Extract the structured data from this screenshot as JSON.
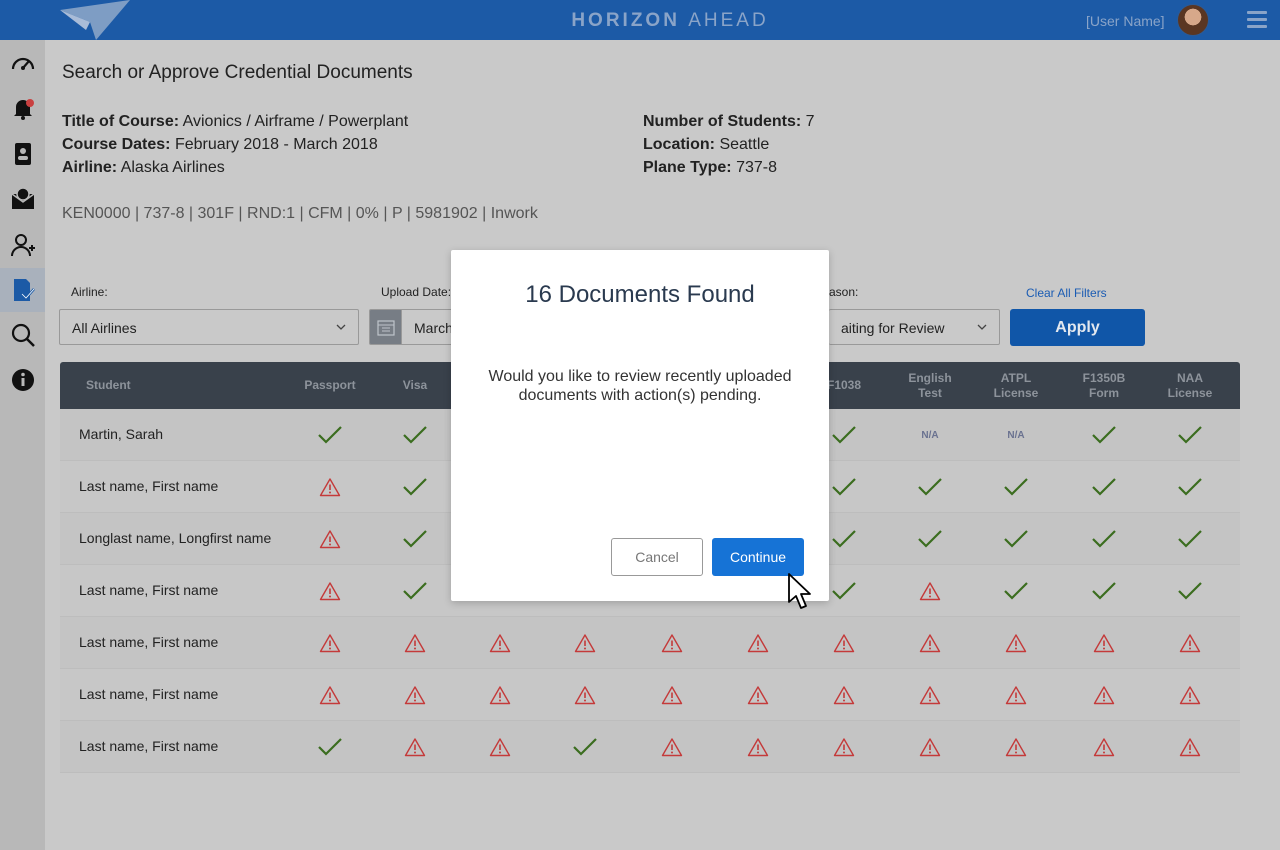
{
  "header": {
    "brand_bold": "HORIZON",
    "brand_light": "AHEAD",
    "user_name": "[User Name]"
  },
  "sidebar": {
    "items": [
      {
        "icon": "speedometer-icon"
      },
      {
        "icon": "bell-icon",
        "badge": "notification"
      },
      {
        "icon": "id-card-icon"
      },
      {
        "icon": "mail-badge-icon"
      },
      {
        "icon": "add-user-icon"
      },
      {
        "icon": "document-check-icon",
        "active": true
      },
      {
        "icon": "search-icon"
      },
      {
        "icon": "info-icon"
      }
    ]
  },
  "page": {
    "title": "Search or Approve Credential Documents",
    "course_title_label": "Title of Course:",
    "course_title": "Avionics / Airframe / Powerplant",
    "course_dates_label": "Course Dates:",
    "course_dates": "February 2018 - March 2018",
    "airline_label": "Airline:",
    "airline": "Alaska Airlines",
    "students_label": "Number of Students:",
    "students": "7",
    "location_label": "Location:",
    "location": "Seattle",
    "plane_label": "Plane Type:",
    "plane": "737-8",
    "summary": "KEN0000 | 737-8 | 301F | RND:1  |  CFM |  0%  |  P  |  5981902  | Inwork"
  },
  "filters": {
    "airline_label": "Airline:",
    "airline_value": "All Airlines",
    "upload_label": "Upload Date:",
    "upload_value": "March",
    "reason_label": "ason:",
    "reason_value": "aiting for Review",
    "clear_label": "Clear All Filters",
    "apply_label": "Apply"
  },
  "table": {
    "headers": [
      "Student",
      "Passport",
      "Visa",
      "",
      "",
      "",
      "",
      "F1038",
      "English Test",
      "ATPL License",
      "F1350B Form",
      "NAA License"
    ],
    "rows": [
      {
        "name": "Martin, Sarah",
        "cells": [
          "check",
          "check",
          "",
          "",
          "",
          "",
          "check",
          "na",
          "na",
          "check",
          "check"
        ]
      },
      {
        "name": "Last name, First name",
        "cells": [
          "warn",
          "check",
          "",
          "",
          "",
          "",
          "check",
          "check",
          "check",
          "check",
          "check"
        ]
      },
      {
        "name": "Longlast name, Longfirst name",
        "cells": [
          "warn",
          "check",
          "",
          "",
          "",
          "",
          "check",
          "check",
          "check",
          "check",
          "check"
        ]
      },
      {
        "name": "Last name, First name",
        "cells": [
          "warn",
          "check",
          "",
          "",
          "",
          "",
          "check",
          "warn",
          "check",
          "check",
          "check"
        ]
      },
      {
        "name": "Last name, First name",
        "cells": [
          "warn",
          "warn",
          "warn",
          "warn",
          "warn",
          "warn",
          "warn",
          "warn",
          "warn",
          "warn",
          "warn"
        ]
      },
      {
        "name": "Last name, First name",
        "cells": [
          "warn",
          "warn",
          "warn",
          "warn",
          "warn",
          "warn",
          "warn",
          "warn",
          "warn",
          "warn",
          "warn"
        ]
      },
      {
        "name": "Last name, First name",
        "cells": [
          "check",
          "warn",
          "warn",
          "check",
          "warn",
          "warn",
          "warn",
          "warn",
          "warn",
          "warn",
          "warn"
        ]
      }
    ],
    "na_label": "N/A"
  },
  "modal": {
    "title": "16 Documents Found",
    "body": "Would you like to review recently uploaded documents with action(s) pending.",
    "cancel_label": "Cancel",
    "continue_label": "Continue"
  },
  "colors": {
    "primary": "#1c5aa6",
    "check": "#3b6d1f",
    "warn": "#c43a3a",
    "continue": "#1673d6"
  }
}
